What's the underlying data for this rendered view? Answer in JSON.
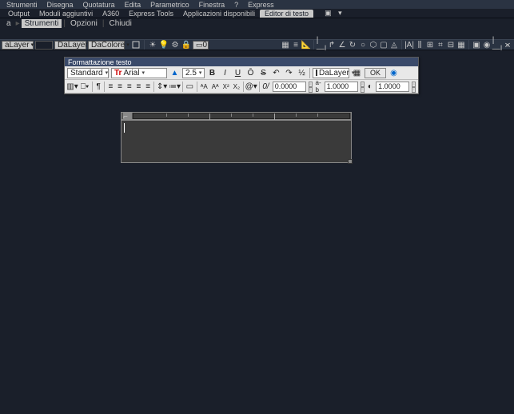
{
  "menubar": [
    "Strumenti",
    "Disegna",
    "Quotatura",
    "Edita",
    "Parametrico",
    "Finestra",
    "?",
    "Express"
  ],
  "ribbon_tabs": {
    "items": [
      "Output",
      "Moduli aggiuntivi",
      "A360",
      "Express Tools",
      "Applicazioni disponibili",
      "Editor di testo"
    ],
    "active_index": 5,
    "help_icon": "▾"
  },
  "subtoolbar": {
    "crumb_a": "a",
    "arrow": "▸",
    "items": [
      "Strumenti",
      "Opzioni",
      "Chiudi"
    ],
    "active_index": 0
  },
  "prop_toolbar": {
    "layer": "aLayer",
    "linetype": "DaLayer",
    "color": "DaColore",
    "lineweight": "0",
    "right_icons": [
      "|—|",
      "↱",
      "∠",
      "↻",
      "○",
      "⬡",
      "▢",
      "◬",
      "|A|",
      "⫼",
      "⊞",
      "⌗",
      "⊟",
      "▦",
      "▣",
      "◉",
      "|—|",
      "⪤"
    ]
  },
  "fmt_panel": {
    "title": "Formattazione testo",
    "style": "Standard",
    "font_prefix": "Tr",
    "font": "Arial",
    "size": "2.5",
    "bold": "B",
    "italic": "I",
    "underline": "U",
    "overline": "Ō",
    "strike": "̶",
    "color_combo": "DaLayer",
    "ok": "OK",
    "row2": {
      "tracking": "0.0000",
      "width_factor": "1.0000",
      "oblique": "1.0000"
    }
  },
  "ruler_ticks": [
    15,
    25,
    35,
    45,
    55,
    65,
    75,
    85
  ]
}
